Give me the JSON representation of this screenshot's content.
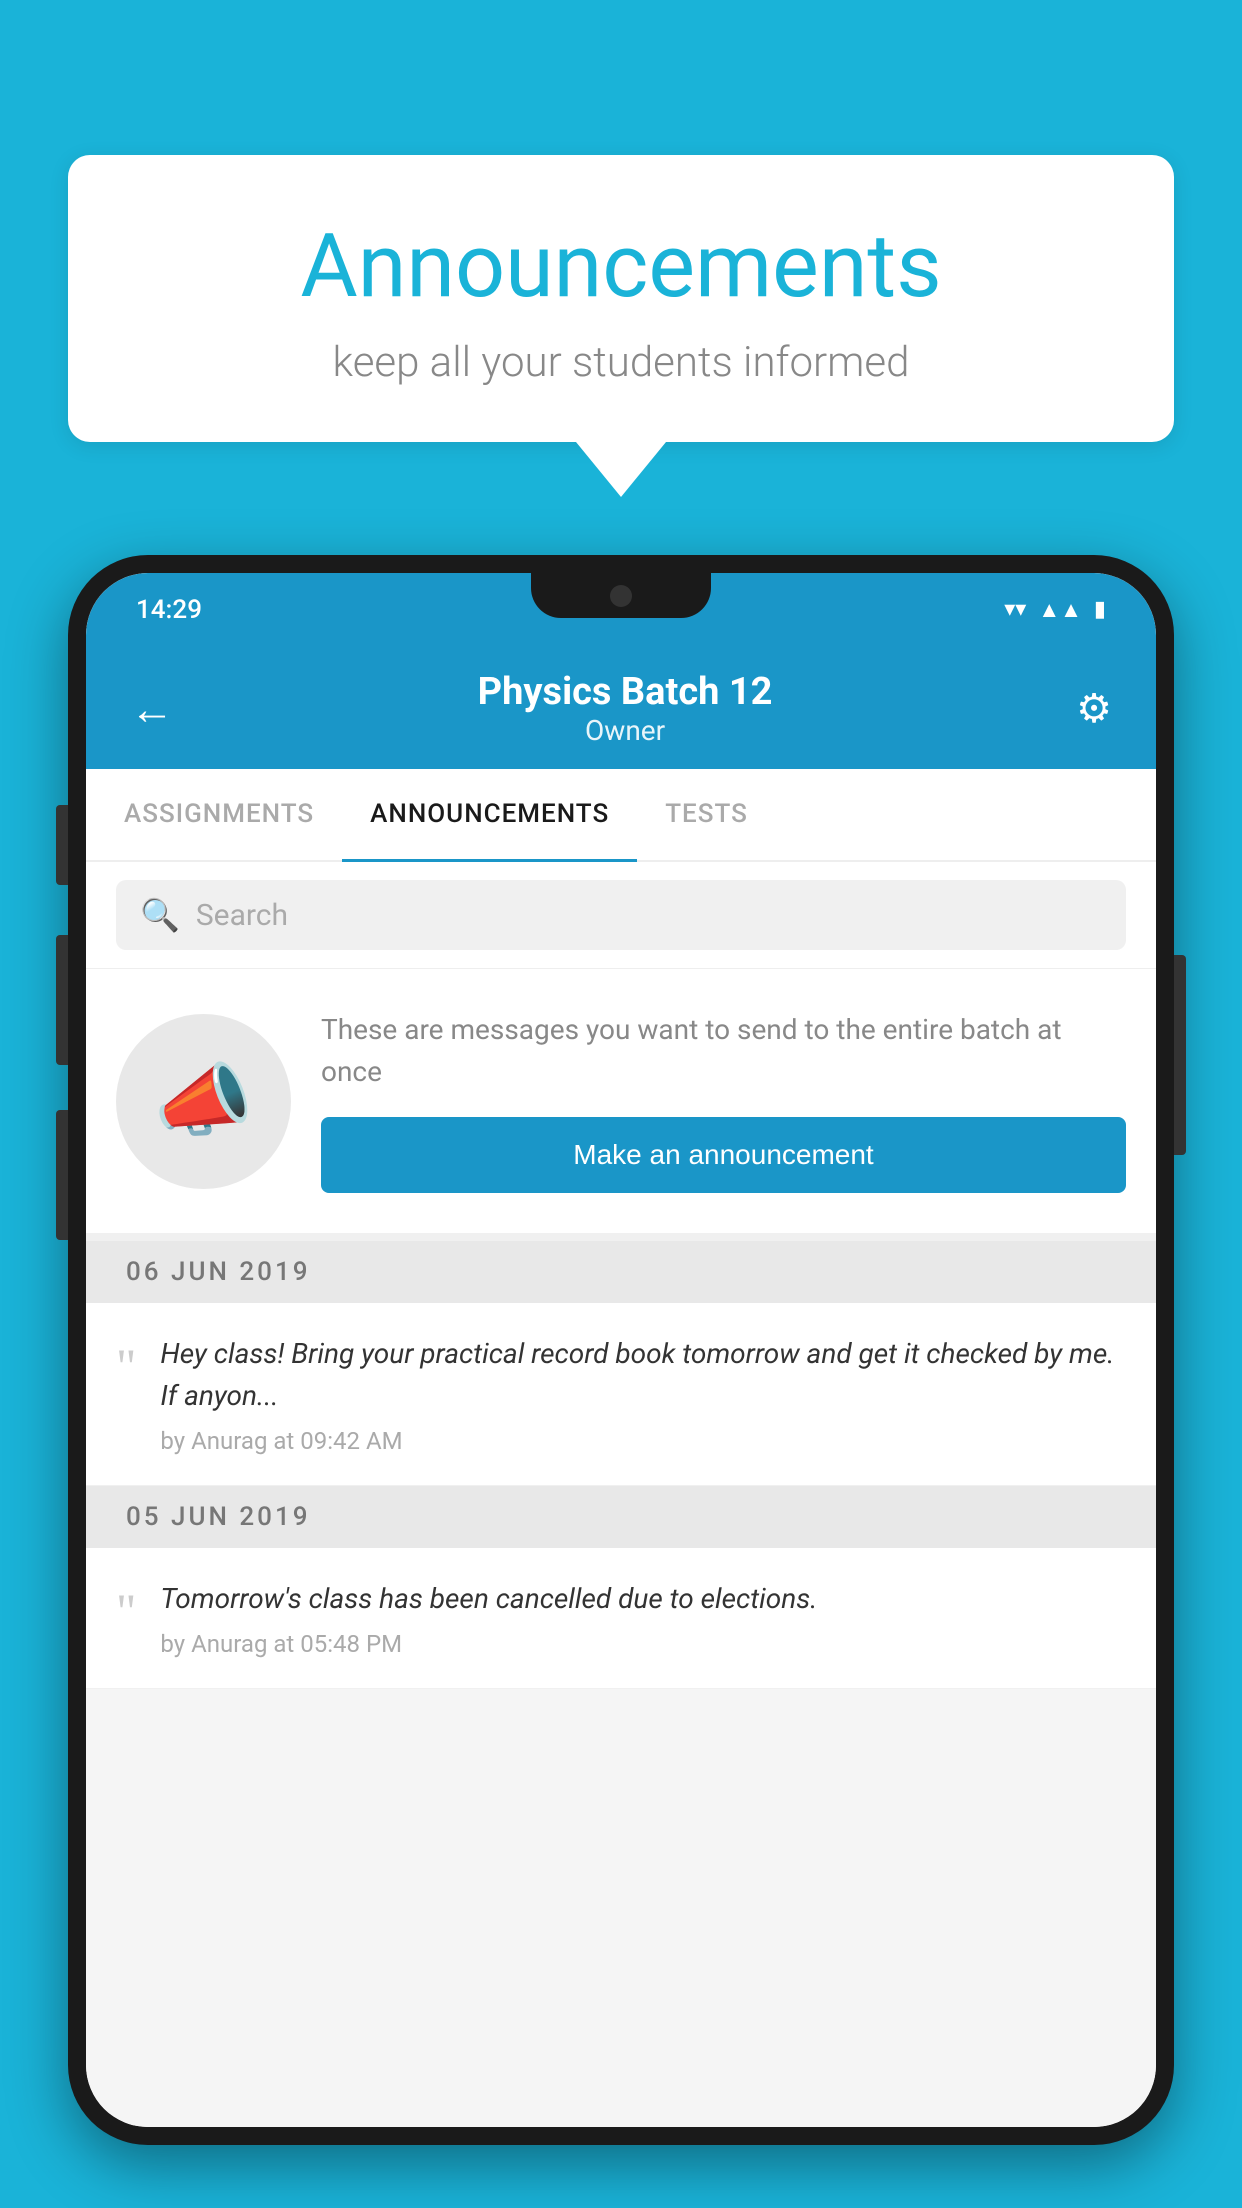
{
  "background_color": "#1ab3d8",
  "speech_bubble": {
    "title": "Announcements",
    "subtitle": "keep all your students informed"
  },
  "phone": {
    "status_bar": {
      "time": "14:29",
      "wifi_icon": "wifi",
      "signal_icon": "signal",
      "battery_icon": "battery"
    },
    "header": {
      "back_label": "←",
      "title": "Physics Batch 12",
      "subtitle": "Owner",
      "settings_label": "⚙"
    },
    "tabs": [
      {
        "label": "ASSIGNMENTS",
        "active": false
      },
      {
        "label": "ANNOUNCEMENTS",
        "active": true
      },
      {
        "label": "TESTS",
        "active": false
      }
    ],
    "search": {
      "placeholder": "Search"
    },
    "announcement_prompt": {
      "description": "These are messages you want to send to the entire batch at once",
      "button_label": "Make an announcement"
    },
    "announcements": [
      {
        "date": "06  JUN  2019",
        "message": "Hey class! Bring your practical record book tomorrow and get it checked by me. If anyon...",
        "meta": "by Anurag at 09:42 AM"
      },
      {
        "date": "05  JUN  2019",
        "message": "Tomorrow's class has been cancelled due to elections.",
        "meta": "by Anurag at 05:48 PM"
      }
    ]
  }
}
